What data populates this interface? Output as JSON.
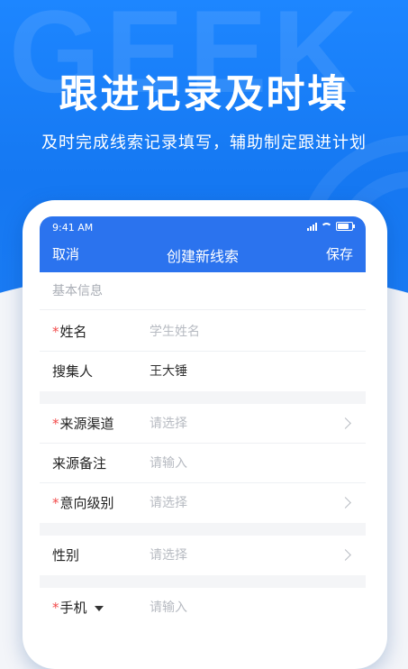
{
  "hero": {
    "watermark": "GEEK",
    "headline": "跟进记录及时填",
    "subline": "及时完成线索记录填写，辅助制定跟进计划"
  },
  "status_bar": {
    "time": "9:41 AM",
    "icons": [
      "signal-icon",
      "wifi-icon",
      "battery-icon"
    ]
  },
  "nav": {
    "cancel": "取消",
    "title": "创建新线索",
    "save": "保存"
  },
  "form": {
    "section_basic": "基本信息",
    "name": {
      "label": "姓名",
      "placeholder": "学生姓名",
      "required": true
    },
    "collector": {
      "label": "搜集人",
      "value": "王大锤"
    },
    "source_channel": {
      "label": "来源渠道",
      "placeholder": "请选择",
      "required": true
    },
    "source_note": {
      "label": "来源备注",
      "placeholder": "请输入"
    },
    "intent_level": {
      "label": "意向级别",
      "placeholder": "请选择",
      "required": true
    },
    "gender": {
      "label": "性别",
      "placeholder": "请选择"
    },
    "phone": {
      "label": "手机",
      "placeholder": "请输入",
      "required": true
    },
    "required_mark": "*"
  },
  "colors": {
    "brand_blue": "#2b73ee",
    "hero_blue": "#1d86ff",
    "required_red": "#f24b4b",
    "placeholder_gray": "#b7bbc2"
  }
}
